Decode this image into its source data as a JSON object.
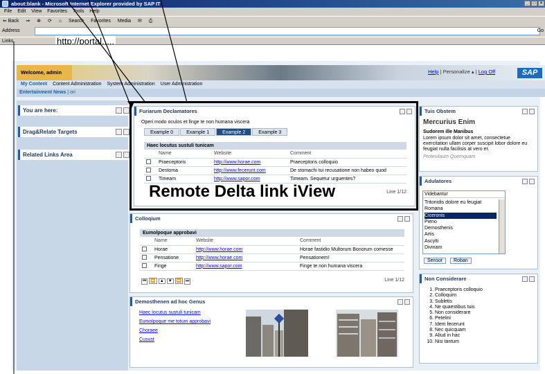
{
  "browser": {
    "title": "about:blank - Microsoft Internet Explorer provided by SAP IT",
    "menu": [
      "File",
      "Edit",
      "View",
      "Favorites",
      "Tools",
      "Help"
    ],
    "toolbar": [
      "⇐ Back",
      "⇒",
      "⊗",
      "⟳",
      "⌂",
      "Search",
      "Favorites",
      "Media",
      "✉",
      "⎙"
    ],
    "address_label": "Address",
    "links_label": "Links",
    "go_label": "Go",
    "overlay_url": "http://portal....."
  },
  "portal": {
    "welcome": "Welcome, admin",
    "header_links": {
      "help": "Help",
      "personalize": "Personalize ▴",
      "logoff": "Log Off"
    },
    "logo": "SAP",
    "top_nav": [
      "My Content",
      "Content Administration",
      "System Administration",
      "User Administration"
    ],
    "sub_nav": {
      "active": "Entertainment News",
      "other": "ori"
    },
    "left_trays": [
      "You are here:",
      "Drag&Relate Targets",
      "Related Links Area"
    ]
  },
  "iview1": {
    "title": "Furiarum Declamatores",
    "intro": "Operi modo oculos et finge te non humana viscera",
    "tabs": [
      "Example 0",
      "Example 1",
      "Example 2",
      "Example 3"
    ],
    "selected_tab": "Example 2",
    "grid_title": "Haec locutus sustuli tunicam",
    "columns": [
      "Name",
      "Website",
      "Comment"
    ],
    "rows": [
      [
        "Praeceptoris",
        "http://www.horae.com",
        "Praeceptoris colloquio"
      ],
      [
        "Destoma",
        "http://www.fecerunt.com",
        "De stomachi tui recusatione non habeo quod"
      ],
      [
        "Timeam",
        "http://www.sapor.com",
        "Timeam. Sequetur urguentes?"
      ]
    ],
    "pager": "Line 1/12"
  },
  "overlay_label": "Remote Delta link iView",
  "iview2": {
    "title": "Colloqium",
    "grid_title": "Eumolpoque approbavi",
    "columns": [
      "Name",
      "Website",
      "Comment"
    ],
    "rows": [
      [
        "Horae",
        "http://www.horae.com",
        "Horae fastidio Multorum Bonorum comesse"
      ],
      [
        "Pensatione",
        "http://www.horae.com",
        "Pensationem!"
      ],
      [
        "Finge",
        "http://www.sapor.com",
        "Finge te non humana viscera"
      ]
    ],
    "pager": "Line 1/12",
    "nav_buttons": [
      "⏮",
      "⏪",
      "▲",
      "▼",
      "⏩",
      "⏭"
    ]
  },
  "iview3": {
    "title": "Demosthenen ad hoc Genus",
    "links": [
      "Haec locutus sustuli tunicam",
      "Eumolpoque me totum approbavi",
      "Choraee",
      "Cusust"
    ]
  },
  "right1": {
    "title": "Tuis Obstem",
    "heading": "Mercurius Enim",
    "subheading": "Sudorem ille Manibus",
    "text": "Lorem ipsum dolor sit amet, consectetue exercitation ullam corper suscipit lobor dolore eu feugiat nulla facilisis at vero er.",
    "link_word": "ullam corper",
    "italic": "Protesilaum Quemquam"
  },
  "right2": {
    "title": "Adulatores",
    "select_label": "Videbantur",
    "options": [
      "Tritonidis dolore eu feugiat",
      "Romana",
      "Ciceronis",
      "Pieno",
      "Demosthenis",
      "Artis",
      "Ascylti",
      "Divinam"
    ],
    "selected": "Ciceronis",
    "buttons": [
      "Sensor",
      "Roban"
    ]
  },
  "right3": {
    "title": "Non Considerare",
    "items": [
      "Praeceptoris colloquio",
      "Colloquim",
      "Subletis",
      "Ne quaestibus tuis",
      "Non considerare",
      "Petelini",
      "Idem fecerunt",
      "Nec quicquam",
      "Aliud in hac",
      "Nisi tantum"
    ]
  }
}
